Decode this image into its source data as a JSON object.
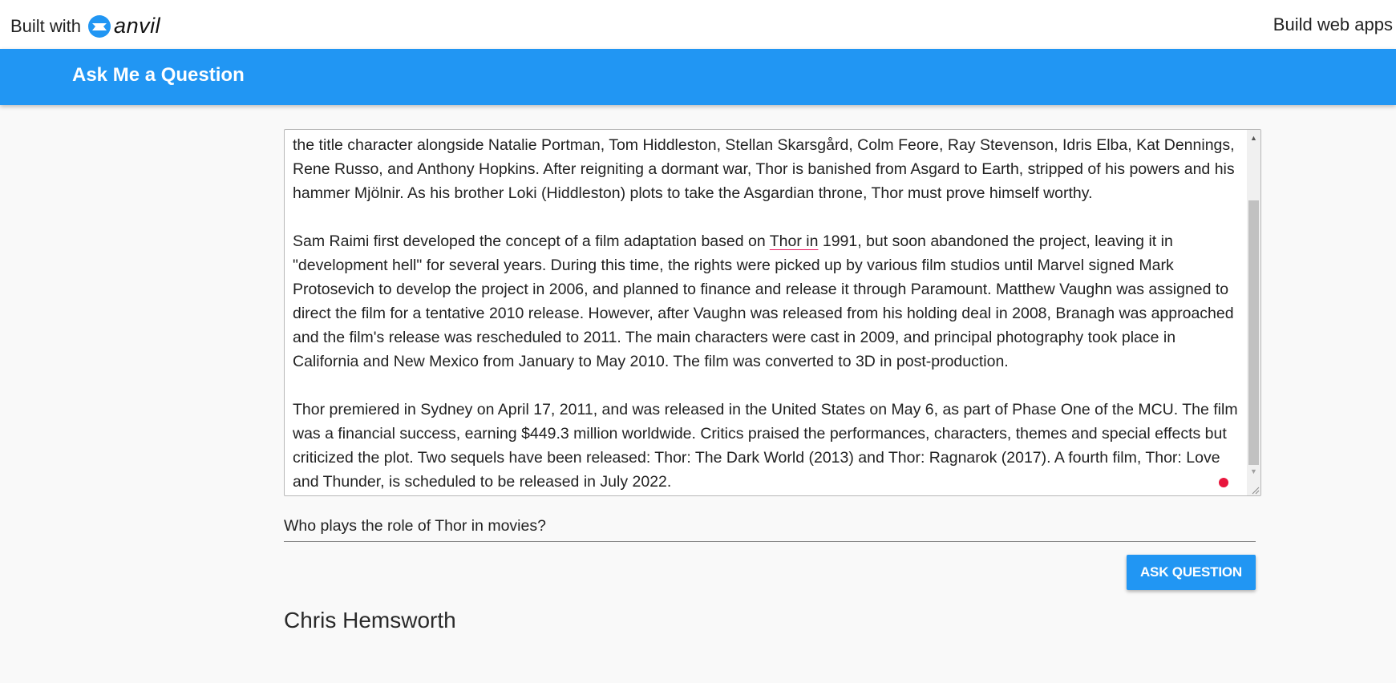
{
  "header": {
    "built_with": "Built with",
    "brand": "anvil",
    "tagline": "Build web apps"
  },
  "appbar": {
    "title": "Ask Me a Question"
  },
  "context": {
    "paragraphs": [
      "the title character alongside Natalie Portman, Tom Hiddleston, Stellan Skarsgård, Colm Feore, Ray Stevenson, Idris Elba, Kat Dennings, Rene Russo, and Anthony Hopkins. After reigniting a dormant war, Thor is banished from Asgard to Earth, stripped of his powers and his hammer Mjölnir. As his brother Loki (Hiddleston) plots to take the Asgardian throne, Thor must prove himself worthy.",
      "Thor premiered in Sydney on April 17, 2011, and was released in the United States on May 6, as part of Phase One of the MCU. The film was a financial success, earning $449.3 million worldwide. Critics praised the performances, characters, themes and special effects but criticized the plot. Two sequels have been released: Thor: The Dark World (2013) and Thor: Ragnarok (2017). A fourth film, Thor: Love and Thunder, is scheduled to be released in July 2022."
    ],
    "p2_before": "Sam Raimi first developed the concept of a film adaptation based on ",
    "p2_underlined": "Thor in",
    "p2_after": " 1991, but soon abandoned the project, leaving it in \"development hell\" for several years. During this time, the rights were picked up by various film studios until Marvel signed Mark Protosevich to develop the project in 2006, and planned to finance and release it through Paramount. Matthew Vaughn was assigned to direct the film for a tentative 2010 release. However, after Vaughn was released from his holding deal in 2008, Branagh was approached and the film's release was rescheduled to 2011. The main characters were cast in 2009, and principal photography took place in California and New Mexico from January to May 2010. The film was converted to 3D in post-production."
  },
  "question": {
    "value": "Who plays the role of Thor in movies?"
  },
  "ask_button": {
    "label": "ASK QUESTION"
  },
  "answer": {
    "text": "Chris Hemsworth"
  },
  "colors": {
    "primary": "#2196f3",
    "background": "#f9f9f9",
    "spellcheck_underline": "#e91e63",
    "indicator_dot": "#e8163d"
  },
  "icons": {
    "logo": "anvil-logo-icon",
    "scroll_up": "scroll-up-arrow-icon",
    "scroll_down": "scroll-down-arrow-icon",
    "resize": "resize-grip-icon"
  }
}
